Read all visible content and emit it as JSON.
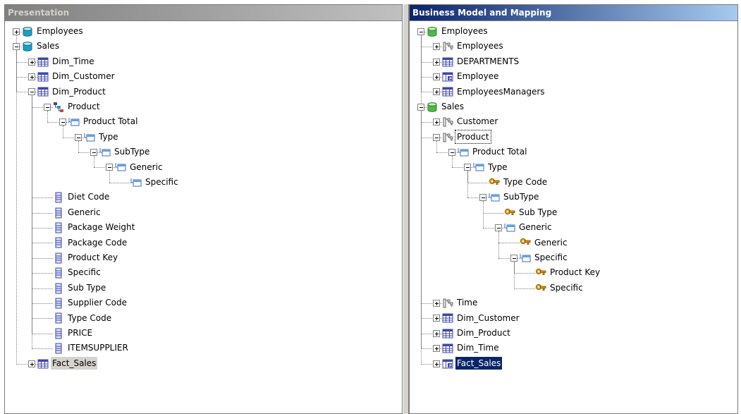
{
  "left_panel": {
    "title": "Presentation",
    "items": [
      {
        "label": "Employees",
        "icon": "catalog-icon",
        "state": "collapsed"
      },
      {
        "label": "Sales",
        "icon": "catalog-icon",
        "state": "expanded"
      },
      {
        "label": "Dim_Time",
        "icon": "table-icon",
        "state": "collapsed"
      },
      {
        "label": "Dim_Customer",
        "icon": "table-icon",
        "state": "collapsed"
      },
      {
        "label": "Dim_Product",
        "icon": "table-icon",
        "state": "expanded"
      },
      {
        "label": "Product",
        "icon": "hierarchy-icon",
        "state": "expanded"
      },
      {
        "label": "Product Total",
        "icon": "level-icon",
        "state": "expanded"
      },
      {
        "label": "Type",
        "icon": "level-icon",
        "state": "expanded"
      },
      {
        "label": "SubType",
        "icon": "level-icon",
        "state": "expanded"
      },
      {
        "label": "Generic",
        "icon": "level-icon",
        "state": "expanded"
      },
      {
        "label": "Specific",
        "icon": "level-icon",
        "state": "leaf"
      },
      {
        "label": "Diet Code",
        "icon": "column-icon",
        "state": "leaf"
      },
      {
        "label": "Generic",
        "icon": "column-icon",
        "state": "leaf"
      },
      {
        "label": "Package Weight",
        "icon": "column-icon",
        "state": "leaf"
      },
      {
        "label": "Package Code",
        "icon": "column-icon",
        "state": "leaf"
      },
      {
        "label": "Product Key",
        "icon": "column-icon",
        "state": "leaf"
      },
      {
        "label": "Specific",
        "icon": "column-icon",
        "state": "leaf"
      },
      {
        "label": "Sub Type",
        "icon": "column-icon",
        "state": "leaf"
      },
      {
        "label": "Supplier Code",
        "icon": "column-icon",
        "state": "leaf"
      },
      {
        "label": "Type Code",
        "icon": "column-icon",
        "state": "leaf"
      },
      {
        "label": "PRICE",
        "icon": "column-icon",
        "state": "leaf"
      },
      {
        "label": "ITEMSUPPLIER",
        "icon": "column-icon",
        "state": "leaf"
      },
      {
        "label": "Fact_Sales",
        "icon": "table-icon",
        "state": "collapsed"
      }
    ]
  },
  "right_panel": {
    "title": "Business Model and Mapping",
    "items": [
      {
        "label": "Employees",
        "icon": "business-model-icon",
        "state": "expanded"
      },
      {
        "label": "Employees",
        "icon": "dimension-icon",
        "state": "collapsed"
      },
      {
        "label": "DEPARTMENTS",
        "icon": "table-icon",
        "state": "collapsed"
      },
      {
        "label": "Employee",
        "icon": "fact-table-icon",
        "state": "collapsed"
      },
      {
        "label": "EmployeesManagers",
        "icon": "table-icon",
        "state": "collapsed"
      },
      {
        "label": "Sales",
        "icon": "business-model-icon",
        "state": "expanded"
      },
      {
        "label": "Customer",
        "icon": "dimension-icon",
        "state": "collapsed"
      },
      {
        "label": "Product",
        "icon": "dimension-icon",
        "state": "expanded"
      },
      {
        "label": "Product Total",
        "icon": "level-icon",
        "state": "expanded"
      },
      {
        "label": "Type",
        "icon": "level-icon",
        "state": "expanded"
      },
      {
        "label": "Type Code",
        "icon": "key-icon",
        "state": "leaf"
      },
      {
        "label": "SubType",
        "icon": "level-icon",
        "state": "expanded"
      },
      {
        "label": "Sub Type",
        "icon": "key-icon",
        "state": "leaf"
      },
      {
        "label": "Generic",
        "icon": "level-icon",
        "state": "expanded"
      },
      {
        "label": "Generic",
        "icon": "key-icon",
        "state": "leaf"
      },
      {
        "label": "Specific",
        "icon": "level-icon",
        "state": "expanded"
      },
      {
        "label": "Product Key",
        "icon": "key-icon",
        "state": "leaf"
      },
      {
        "label": "Specific",
        "icon": "key-icon",
        "state": "leaf"
      },
      {
        "label": "Time",
        "icon": "dimension-icon",
        "state": "collapsed"
      },
      {
        "label": "Dim_Customer",
        "icon": "table-icon",
        "state": "collapsed"
      },
      {
        "label": "Dim_Product",
        "icon": "table-icon",
        "state": "collapsed"
      },
      {
        "label": "Dim_Time",
        "icon": "table-icon",
        "state": "collapsed"
      },
      {
        "label": "Fact_Sales",
        "icon": "fact-table-icon",
        "state": "collapsed",
        "selected": true
      }
    ]
  },
  "colors": {
    "selection": "#0a246a",
    "header_active": "#0a246a",
    "header_inactive": "#808080",
    "table_blue": "#3d46a8",
    "cube_teal": "#1e9fc0",
    "business_green": "#4fb84a",
    "key_gold": "#e8a21a"
  }
}
